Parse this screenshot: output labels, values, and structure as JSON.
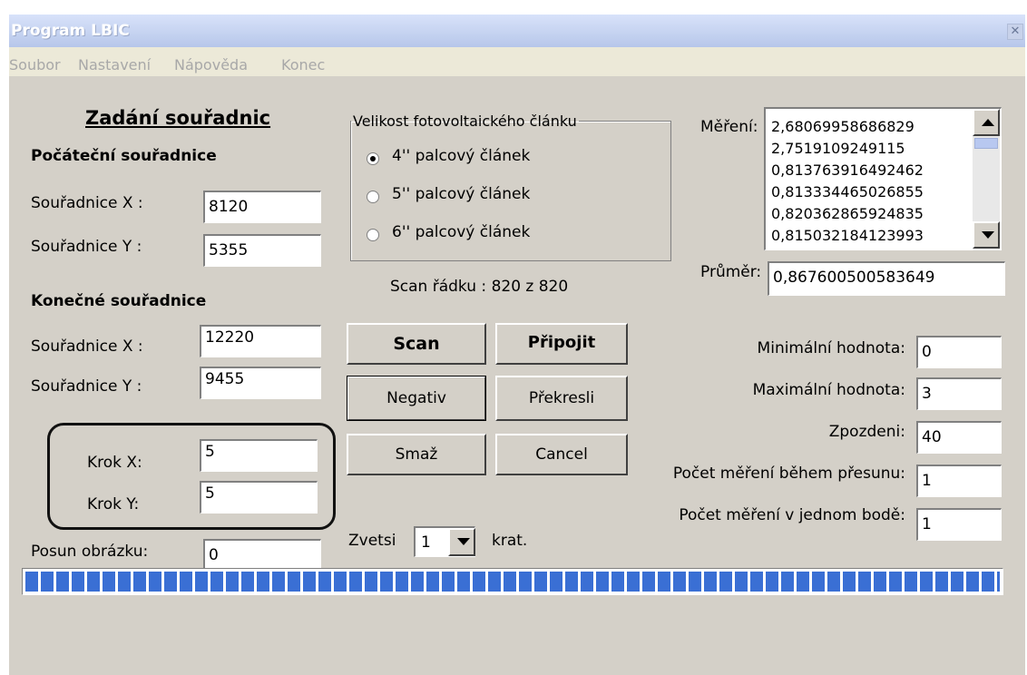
{
  "window": {
    "title": "Program LBIC",
    "close_glyph": "✕"
  },
  "menu": [
    "Soubor",
    "Nastavení",
    "Nápověda",
    "Konec"
  ],
  "left_panel": {
    "heading": "Zadání souřadnic",
    "start": {
      "heading": "Počáteční souřadnice",
      "x_label": "Souřadnice X :",
      "x_value": "8120",
      "y_label": "Souřadnice Y :",
      "y_value": "5355"
    },
    "end": {
      "heading": "Konečné souřadnice",
      "x_label": "Souřadnice X :",
      "x_value": "12220",
      "y_label": "Souřadnice Y :",
      "y_value": "9455"
    },
    "step": {
      "x_label": "Krok X:",
      "x_value": "5",
      "y_label": "Krok Y:",
      "y_value": "5"
    },
    "shift_label": "Posun obrázku:",
    "shift_value": "0"
  },
  "cell_size": {
    "legend": "Velikost fotovoltaického článku",
    "options": [
      "4'' palcový článek",
      "5'' palcový článek",
      "6'' palcový článek"
    ],
    "selected_index": 0
  },
  "scan_status": "Scan řádku : 820 z 820",
  "buttons": {
    "scan": "Scan",
    "connect": "Připojit",
    "negative": "Negativ",
    "redraw": "Překresli",
    "delete": "Smaž",
    "cancel": "Cancel"
  },
  "zoom": {
    "label": "Zvetsi",
    "value": "1",
    "suffix": "krat."
  },
  "measurements": {
    "label": "Měření:",
    "values": [
      "2,68069958686829",
      "2,7519109249115",
      "0,813763916492462",
      "0,813334465026855",
      "0,820362865924835",
      "0,815032184123993"
    ]
  },
  "average": {
    "label": "Průměr:",
    "value": "0,867600500583649"
  },
  "settings": [
    {
      "label": "Minimální hodnota:",
      "value": "0"
    },
    {
      "label": "Maximální hodnota:",
      "value": "3"
    },
    {
      "label": "Zpozdeni:",
      "value": "40"
    },
    {
      "label": "Počet měření během přesunu:",
      "value": "1"
    },
    {
      "label": "Počet měření v jednom bodě:",
      "value": "1"
    }
  ],
  "progress": {
    "fraction": 1.0
  },
  "colors": {
    "progress_block": "#3a6fd4",
    "window_bg": "#d4d0c8",
    "menubar_bg": "#ece9d8"
  }
}
